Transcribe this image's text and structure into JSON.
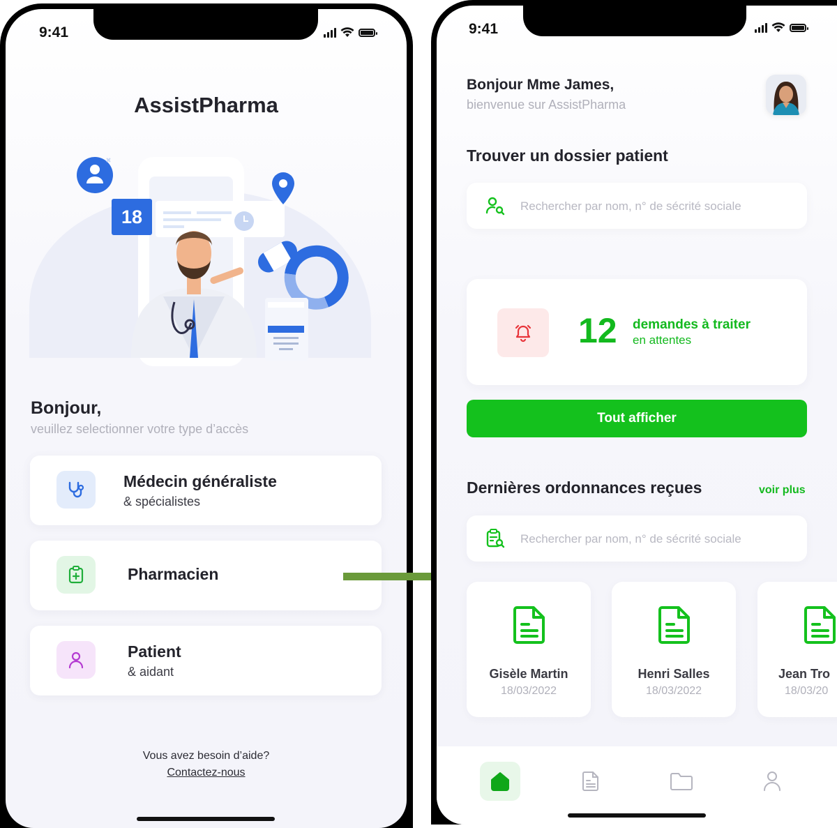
{
  "status": {
    "time": "9:41"
  },
  "left": {
    "app_title": "AssistPharma",
    "calendar_day": "18",
    "greeting": "Bonjour,",
    "greeting_sub": "veuillez selectionner votre type d’accès",
    "access_options": [
      {
        "title": "Médecin généraliste",
        "subtitle": "& spécialistes",
        "icon": "stethoscope-icon",
        "color": "#2d6ce0",
        "bg": "#e3ecfb"
      },
      {
        "title": "Pharmacien",
        "subtitle": "",
        "icon": "clipboard-plus-icon",
        "color": "#1fae3a",
        "bg": "#e2f6e5"
      },
      {
        "title": "Patient",
        "subtitle": "& aidant",
        "icon": "user-icon",
        "color": "#b43ad1",
        "bg": "#f6e4fa"
      }
    ],
    "help_text": "Vous avez besoin d’aide?",
    "help_link": "Contactez-nous"
  },
  "right": {
    "greeting": "Bonjour Mme James,",
    "greeting_sub": "bienvenue sur AssistPharma",
    "find_patient_title": "Trouver un dossier patient",
    "search_placeholder": "Rechercher par nom, n° de sécrité sociale",
    "pending": {
      "count": "12",
      "label": "demandes à traiter",
      "sub": "en attentes"
    },
    "show_all_button": "Tout afficher",
    "prescriptions_title": "Dernières ordonnances reçues",
    "see_more": "voir plus",
    "prescriptions_search_placeholder": "Rechercher par nom, n° de sécrité sociale",
    "prescriptions": [
      {
        "name": "Gisèle Martin",
        "date": "18/03/2022"
      },
      {
        "name": "Henri Salles",
        "date": "18/03/2022"
      },
      {
        "name": "Jean Tro",
        "date": "18/03/20"
      }
    ],
    "tabs": [
      {
        "name": "tab-home",
        "icon": "home-icon",
        "active": true
      },
      {
        "name": "tab-prescriptions",
        "icon": "document-icon",
        "active": false
      },
      {
        "name": "tab-folders",
        "icon": "folder-icon",
        "active": false
      },
      {
        "name": "tab-profile",
        "icon": "user-icon",
        "active": false
      }
    ]
  },
  "colors": {
    "green": "#14c11d",
    "blue": "#2d6ce0",
    "alert_red": "#e8343a",
    "purple": "#b43ad1"
  }
}
